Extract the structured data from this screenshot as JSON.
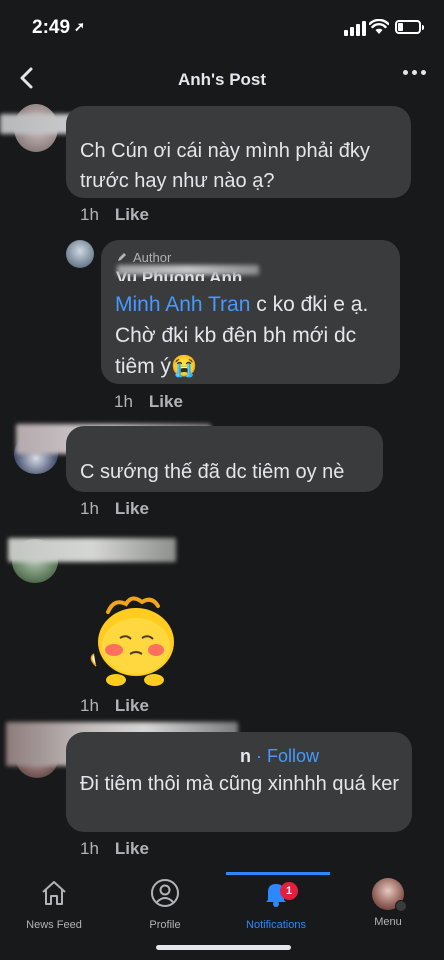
{
  "status": {
    "time": "2:49",
    "signal_bars": 4
  },
  "header": {
    "title": "Anh's Post"
  },
  "comments": [
    {
      "text": "Ch Cún ơi cái này mình phải đky trước hay như nào ạ?",
      "time": "1h",
      "like": "Like"
    },
    {
      "author_label": "Author",
      "name": "Vu Phuong Anh",
      "mention": "Minh Anh Tran",
      "text": " c ko đki e ạ. Chờ đki kb đên bh mới dc tiêm ý😭",
      "time": "1h",
      "like": "Like"
    },
    {
      "text": "C sướng thế đã dc tiêm oy nè",
      "time": "1h",
      "like": "Like"
    },
    {
      "time": "1h",
      "like": "Like"
    },
    {
      "name_suffix": "n",
      "follow": "· Follow",
      "text": "Đi tiêm thôi mà cũng xinhhh quá ker",
      "time": "1h",
      "like": "Like"
    }
  ],
  "nav": {
    "items": [
      {
        "label": "News Feed"
      },
      {
        "label": "Profile"
      },
      {
        "label": "Notifications",
        "badge": "1"
      },
      {
        "label": "Menu"
      }
    ]
  },
  "colors": {
    "background": "#18191a",
    "bubble": "#3a3b3c",
    "accent": "#2d88ff",
    "link": "#4599ff",
    "badge": "#e41e3f"
  }
}
